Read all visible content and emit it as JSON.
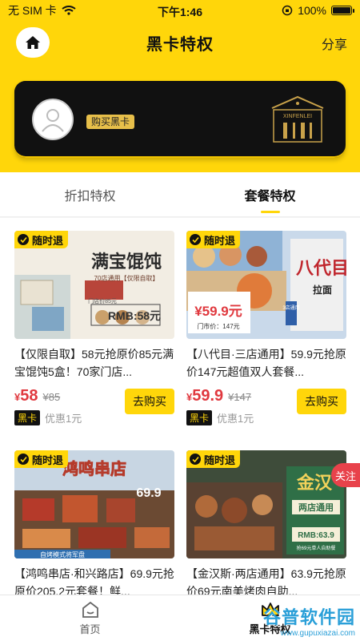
{
  "status_bar": {
    "carrier": "无 SIM 卡",
    "time": "下午1:46",
    "battery": "100%",
    "battery_level": 1.0
  },
  "nav": {
    "title": "黑卡特权",
    "share": "分享"
  },
  "card": {
    "buy_label": "购买黑卡",
    "logo_text": "XINFENLEI"
  },
  "tabs": [
    {
      "label": "折扣特权"
    },
    {
      "label": "套餐特权"
    }
  ],
  "active_tab": 1,
  "items": [
    {
      "tag": "随时退",
      "title": "【仅限自取】58元抢原价85元满宝馄饨5盒！70家门店...",
      "price": "58",
      "currency": "¥",
      "original": "¥85",
      "member_badge": "黑卡",
      "member_text": "优惠1元",
      "buy": "去购买",
      "image": {
        "headline": "满宝馄饨",
        "sub": "70店通用【仅限自取】",
        "price_tag": "RMB:58元",
        "strap": "门店价85元",
        "colors": [
          "#f2ede3",
          "#cfd8d6"
        ]
      }
    },
    {
      "tag": "随时退",
      "title": "【八代目·三店通用】59.9元抢原价147元超值双人套餐...",
      "price": "59.9",
      "currency": "¥",
      "original": "¥147",
      "member_badge": "黑卡",
      "member_text": "优惠1元",
      "buy": "去购买",
      "image": {
        "headline": "八代目",
        "sub": "拉面",
        "price_tag": "¥59.9元",
        "strap": "门市价：147元",
        "badge": "3店通用",
        "colors": [
          "#c9d9ea",
          "#2f5fa8"
        ]
      }
    },
    {
      "tag": "随时退",
      "title": "【鸿鸣串店·和兴路店】69.9元抢原价205.2元套餐！鲜...",
      "image": {
        "headline": "鸿鸣串店",
        "price_tag": "69.9",
        "strap": "自烤模式将军盘",
        "colors": [
          "#c8d6e3",
          "#b53a2a"
        ]
      }
    },
    {
      "tag": "随时退",
      "title": "【金汉斯·两店通用】63.9元抢原价69元南美烤肉自助...",
      "image": {
        "headline": "金汉",
        "sub": "两店通用",
        "price_tag": "RMB:63.9",
        "strap": "抢69元单人自助餐",
        "colors": [
          "#3e4c3a",
          "#2f6f47"
        ]
      }
    }
  ],
  "follow": "关注",
  "bottombar": [
    {
      "label": "首页"
    },
    {
      "label": "黑卡特权"
    }
  ],
  "active_bottom": 1,
  "watermark": {
    "main": "谷普软件园",
    "url": "www.gupuxiazai.com"
  },
  "colors": {
    "brand_yellow": "#ffd60a",
    "price_red": "#e0383e",
    "dark": "#111111"
  }
}
